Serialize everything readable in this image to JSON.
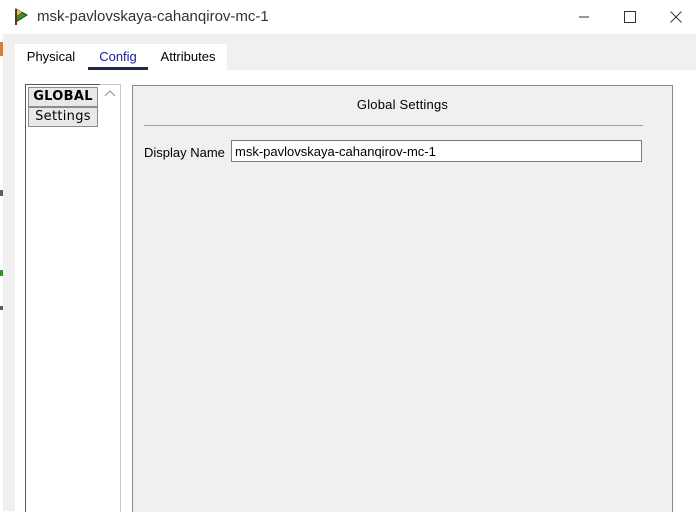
{
  "window": {
    "title": "msk-pavlovskaya-cahanqirov-mc-1",
    "icon": "packet-tracer-device-icon",
    "controls": [
      "minimize",
      "maximize",
      "close"
    ]
  },
  "tabs": [
    {
      "label": "Physical",
      "active": false
    },
    {
      "label": "Config",
      "active": true
    },
    {
      "label": "Attributes",
      "active": false
    }
  ],
  "sidebar": {
    "items": [
      {
        "label": "GLOBAL",
        "type": "header"
      },
      {
        "label": "Settings",
        "type": "button"
      }
    ]
  },
  "global_settings": {
    "heading": "Global Settings",
    "display_name_label": "Display Name",
    "display_name_value": "msk-pavlovskaya-cahanqirov-mc-1"
  },
  "colors": {
    "tab_underline": "#1e2a4a",
    "config_tab_text": "#1a1a9c",
    "content_background": "#f0f0f0"
  }
}
